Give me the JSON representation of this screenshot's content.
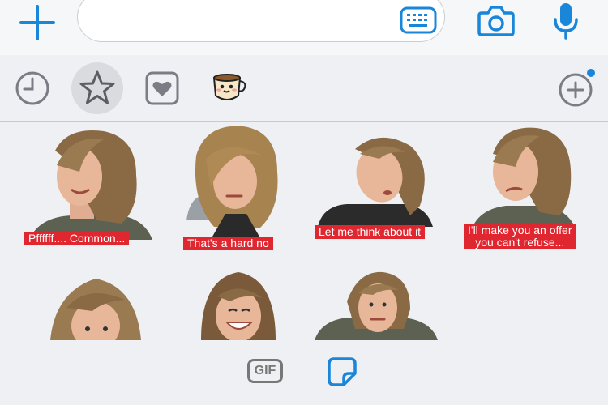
{
  "toolbar": {
    "message_placeholder": "",
    "accent": "#1a86d9"
  },
  "categories": [
    {
      "name": "recent",
      "icon": "clock-icon"
    },
    {
      "name": "favorites",
      "icon": "star-icon",
      "selected": true
    },
    {
      "name": "love",
      "icon": "heart-icon"
    },
    {
      "name": "pack",
      "icon": "coffee-cup-icon"
    },
    {
      "name": "add",
      "icon": "plus-circle-icon",
      "badge_color": "#1a86d9"
    }
  ],
  "stickers": [
    {
      "caption": "Pffffff.... Common..."
    },
    {
      "caption": "That's a hard no"
    },
    {
      "caption": "Let me think about it"
    },
    {
      "caption_line1": "I'll make you an offer",
      "caption_line2": "you can't refuse..."
    },
    {
      "caption": ""
    },
    {
      "caption": ""
    },
    {
      "caption": ""
    }
  ],
  "bottom": {
    "gif_label": "GIF"
  },
  "colors": {
    "caption_bg": "#e0272f",
    "hair": "#8a6a45",
    "skin": "#e8b79a"
  }
}
